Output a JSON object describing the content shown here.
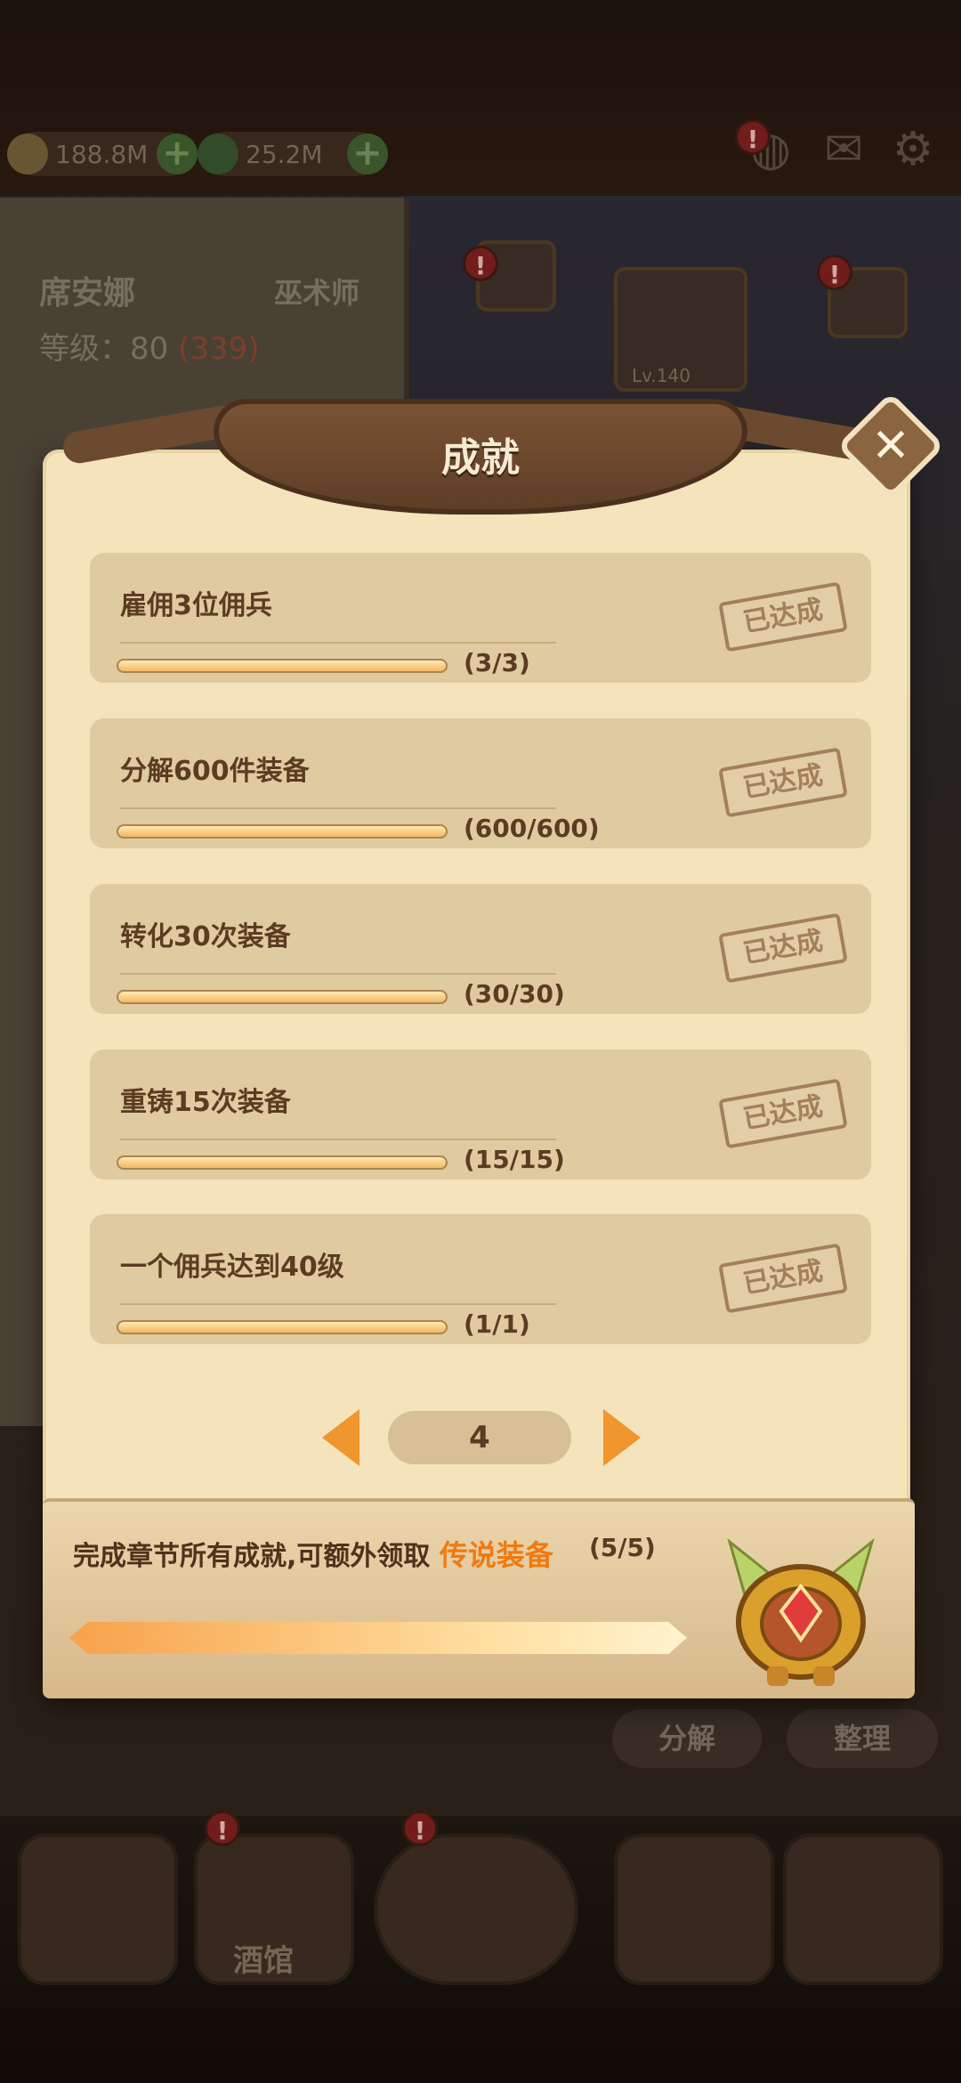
{
  "topbar": {
    "gold": "188.8M",
    "gems": "25.2M"
  },
  "hero": {
    "name": "席安娜",
    "class": "巫术师",
    "level_label": "等级：80",
    "level_extra": "(339)"
  },
  "scene": {
    "hero_level_badge": "Lv.140"
  },
  "bottom_buttons": {
    "disassemble": "分解",
    "organize": "整理"
  },
  "nav": {
    "tavern_label": "酒馆"
  },
  "dialog": {
    "title": "成就",
    "achievements": [
      {
        "name": "雇佣3位佣兵",
        "count": "(3/3)",
        "progress": 1.0,
        "status": "已达成"
      },
      {
        "name": "分解600件装备",
        "count": "(600/600)",
        "progress": 1.0,
        "status": "已达成"
      },
      {
        "name": "转化30次装备",
        "count": "(30/30)",
        "progress": 1.0,
        "status": "已达成"
      },
      {
        "name": "重铸15次装备",
        "count": "(15/15)",
        "progress": 1.0,
        "status": "已达成"
      },
      {
        "name": "一个佣兵达到40级",
        "count": "(1/1)",
        "progress": 1.0,
        "status": "已达成"
      }
    ],
    "page": "4",
    "reward": {
      "text": "完成章节所有成就,可额外领取",
      "highlight": "传说装备",
      "count": "(5/5)",
      "progress": 1.0
    }
  },
  "colors": {
    "accent_orange": "#f07a10",
    "parchment": "#f4e3bb",
    "wood": "#6b4a30"
  }
}
